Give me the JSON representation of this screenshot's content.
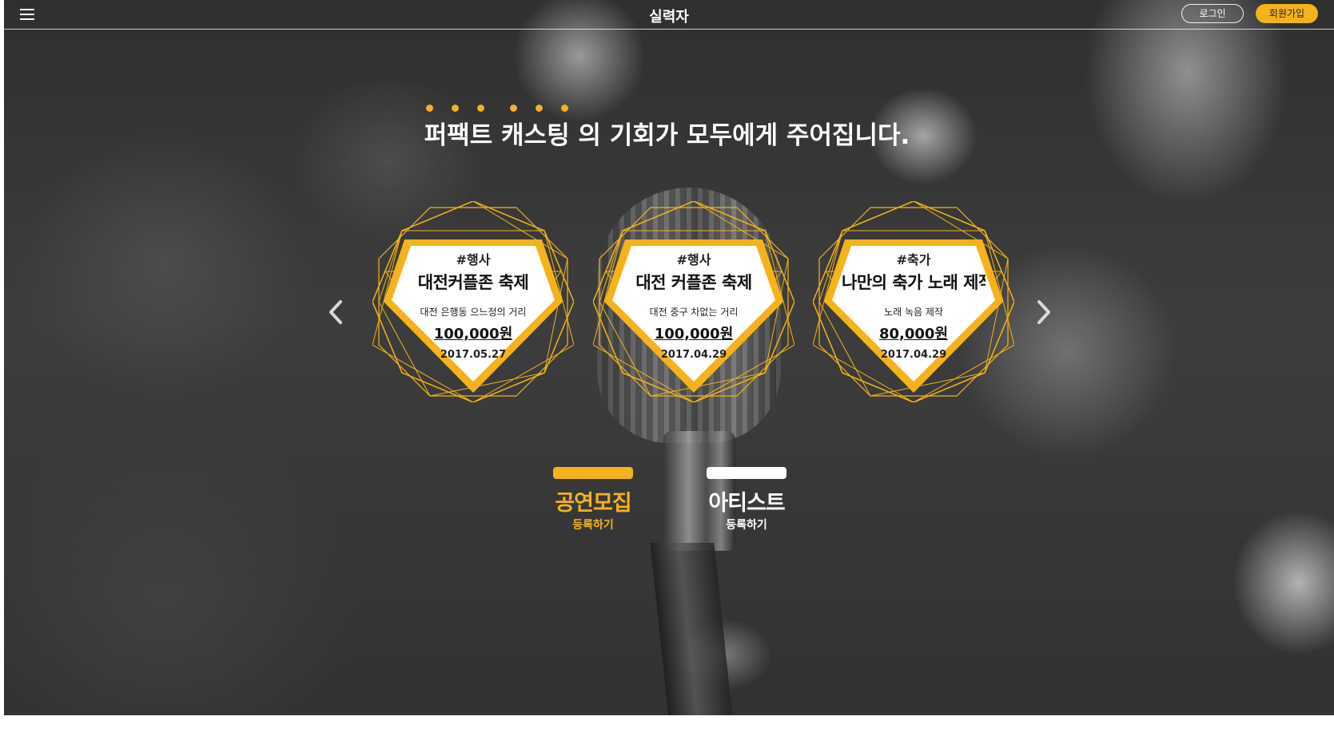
{
  "header": {
    "logo_text": "실력자",
    "login_label": "로그인",
    "join_label": "회원가입",
    "menu_icon": "hamburger-menu-icon"
  },
  "hero": {
    "headline": "퍼팩트 캐스팅 의 기회가 모두에게 주어집니다.",
    "accent_color": "#f4b21b"
  },
  "carousel": {
    "prev_icon": "chevron-left-icon",
    "next_icon": "chevron-right-icon",
    "cards": [
      {
        "tag": "#행사",
        "title": "대전커플존 축제",
        "subtitle": "대전 은행동 으느정의 거리",
        "price": "100,000원",
        "date": "2017.05.27"
      },
      {
        "tag": "#행사",
        "title": "대전 커플존 축제",
        "subtitle": "대전 중구 차없는 거리",
        "price": "100,000원",
        "date": "2017.04.29"
      },
      {
        "tag": "#축가",
        "title": "나만의 축가 노래 제작",
        "subtitle": "노래 녹음 제작",
        "price": "80,000원",
        "date": "2017.04.29"
      }
    ]
  },
  "cta": {
    "recruit_main": "공연모집",
    "recruit_sub": "등록하기",
    "artist_main": "아티스트",
    "artist_sub": "등록하기"
  }
}
